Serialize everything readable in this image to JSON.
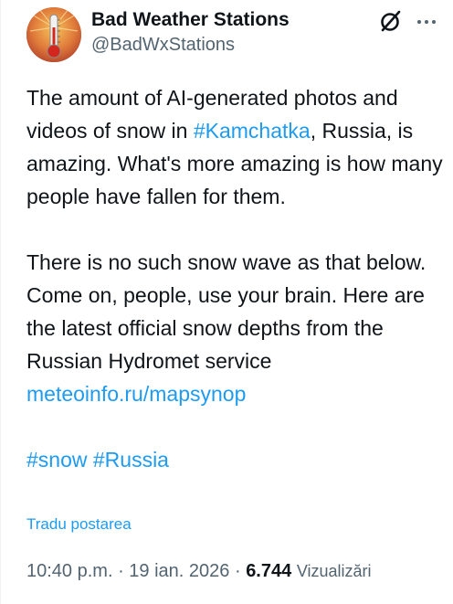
{
  "author": {
    "display_name": "Bad Weather Stations",
    "handle": "@BadWxStations",
    "avatar_icon": "thermometer-sun-avatar"
  },
  "actions": {
    "grok_icon": "grok-slashed-circle-icon",
    "more_icon": "more-dots-icon"
  },
  "tweet": {
    "p1_a": "The amount of AI-generated photos and videos of snow in ",
    "p1_hashtag": "#Kamchatka",
    "p1_b": ", Russia, is amazing. What's more amazing is how many people have fallen for them.",
    "p2_a": "There is no such snow wave as that below. Come on, people, use your brain. Here are the latest official snow depths from the Russian Hydromet service ",
    "p2_link": "meteoinfo.ru/mapsynop",
    "hashtag_1": "#snow",
    "hashtag_2": "#Russia"
  },
  "translate_label": "Tradu postarea",
  "meta": {
    "time": "10:40 p.m.",
    "sep1": " · ",
    "date": "19 ian. 2026",
    "sep2": " · ",
    "views_count": "6.744",
    "views_label": "Vizualizări"
  },
  "colors": {
    "text": "#0f1419",
    "secondary": "#536471",
    "link": "#1d9bf0"
  }
}
